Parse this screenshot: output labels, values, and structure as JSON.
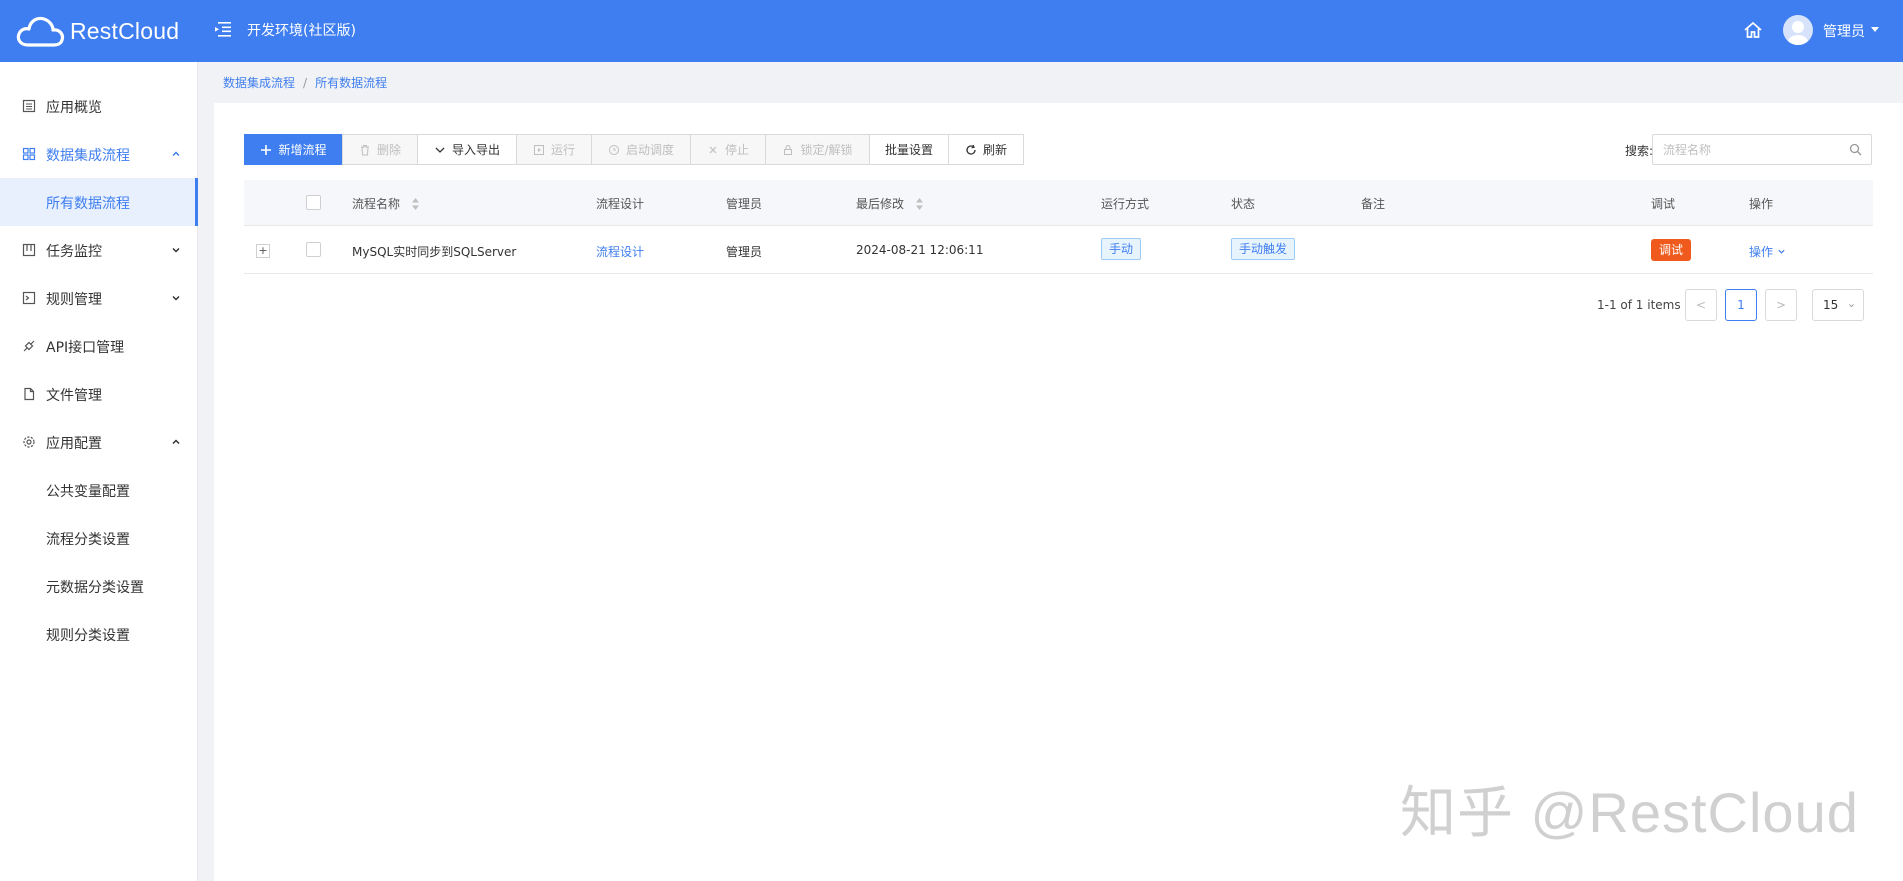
{
  "header": {
    "app_name": "RestCloud",
    "env_title": "开发环境(社区版)",
    "user": "管理员",
    "bg_color": "#3f7ef0"
  },
  "sidebar": {
    "items": [
      {
        "label": "应用概览",
        "icon": "overview-icon"
      },
      {
        "label": "数据集成流程",
        "icon": "grid-icon",
        "expanded": true
      },
      {
        "label": "所有数据流程",
        "sub": true,
        "selected": true
      },
      {
        "label": "任务监控",
        "icon": "monitor-icon"
      },
      {
        "label": "规则管理",
        "icon": "terminal-icon"
      },
      {
        "label": "API接口管理",
        "icon": "api-icon"
      },
      {
        "label": "文件管理",
        "icon": "file-icon"
      },
      {
        "label": "应用配置",
        "icon": "gear-icon",
        "expanded": true
      },
      {
        "label": "公共变量配置",
        "sub": true
      },
      {
        "label": "流程分类设置",
        "sub": true
      },
      {
        "label": "元数据分类设置",
        "sub": true
      },
      {
        "label": "规则分类设置",
        "sub": true
      }
    ]
  },
  "breadcrumb": {
    "parent": "数据集成流程",
    "sep": "/",
    "current": "所有数据流程"
  },
  "toolbar": {
    "new": "新增流程",
    "delete": "删除",
    "import_export": "导入导出",
    "run": "运行",
    "schedule": "启动调度",
    "stop": "停止",
    "lock": "锁定/解锁",
    "batch": "批量设置",
    "refresh": "刷新"
  },
  "search": {
    "label": "搜索:",
    "placeholder": "流程名称"
  },
  "table": {
    "columns": {
      "name": "流程名称",
      "design": "流程设计",
      "admin": "管理员",
      "modified": "最后修改",
      "run_mode": "运行方式",
      "status": "状态",
      "note": "备注",
      "debug": "调试",
      "ops": "操作"
    },
    "rows": [
      {
        "expand": "+",
        "name": "MySQL实时同步到SQLServer",
        "design": "流程设计",
        "admin": "管理员",
        "modified": "2024-08-21 12:06:11",
        "run_mode": "手动",
        "status": "手动触发",
        "note": "",
        "debug": "调试",
        "ops": "操作"
      }
    ]
  },
  "pagination": {
    "info": "1-1 of 1 items",
    "current_page": "1",
    "page_size": "15",
    "prev": "<",
    "next": ">"
  },
  "watermark": "知乎 @RestCloud"
}
